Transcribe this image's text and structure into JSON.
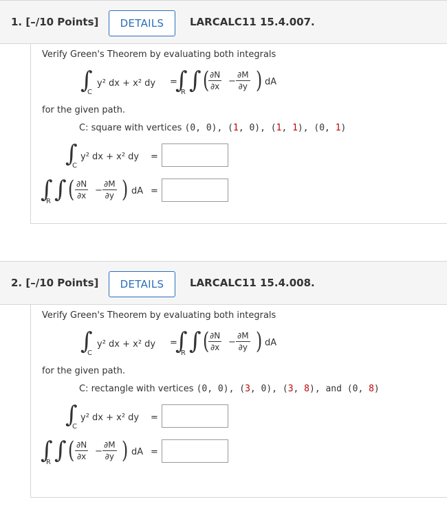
{
  "questions": [
    {
      "number": "1. [–/10 Points]",
      "details_label": "DETAILS",
      "code": "LARCALC11 15.4.007.",
      "instruction": "Verify Green's Theorem by evaluating both integrals",
      "for_path": "for the given path.",
      "path_prefix": "C: square with vertices ",
      "vertices": [
        "(0, 0), ",
        "(1, 0), ",
        "(1, 1), ",
        "(0, 1)"
      ],
      "vertex_parts": [
        {
          "a": "(0, ",
          "b": "0",
          "c": "), "
        },
        {
          "a": "(",
          "b": "1",
          "c": ", 0), "
        },
        {
          "a": "(",
          "b": "1",
          "c": ", "
        },
        {
          "a": "",
          "b": "1",
          "c": "), (0, "
        },
        {
          "a": "",
          "b": "1",
          "c": ")"
        }
      ],
      "answer_line_integral": "",
      "answer_double_integral": ""
    },
    {
      "number": "2. [–/10 Points]",
      "details_label": "DETAILS",
      "code": "LARCALC11 15.4.008.",
      "instruction": "Verify Green's Theorem by evaluating both integrals",
      "for_path": "for the given path.",
      "path_prefix": "C: rectangle with vertices ",
      "answer_line_integral": "",
      "answer_double_integral": ""
    }
  ],
  "math": {
    "integral": "∫",
    "sub_c": "C",
    "sub_r": "R",
    "line_integrand": "y² dx + x² dy",
    "equals": "=",
    "dN": "∂N",
    "dx": "∂x",
    "dM": "∂M",
    "dy": "∂y",
    "minus": "−",
    "dA": "dA",
    "lparen": "(",
    "rparen": ")"
  },
  "q1_vertices": {
    "open1": "(0, 0), (",
    "v1": "1",
    "mid1": ", 0), (",
    "v2": "1",
    "mid2": ", ",
    "v3": "1",
    "mid3": "), (0, ",
    "v4": "1",
    "close": ")"
  },
  "q2_vertices": {
    "open1": "(0, 0), (",
    "v1": "3",
    "mid1": ", 0), (",
    "v2": "3",
    "mid2": ", ",
    "v3": "8",
    "mid3": "), and (0, ",
    "v4": "8",
    "close": ")"
  }
}
